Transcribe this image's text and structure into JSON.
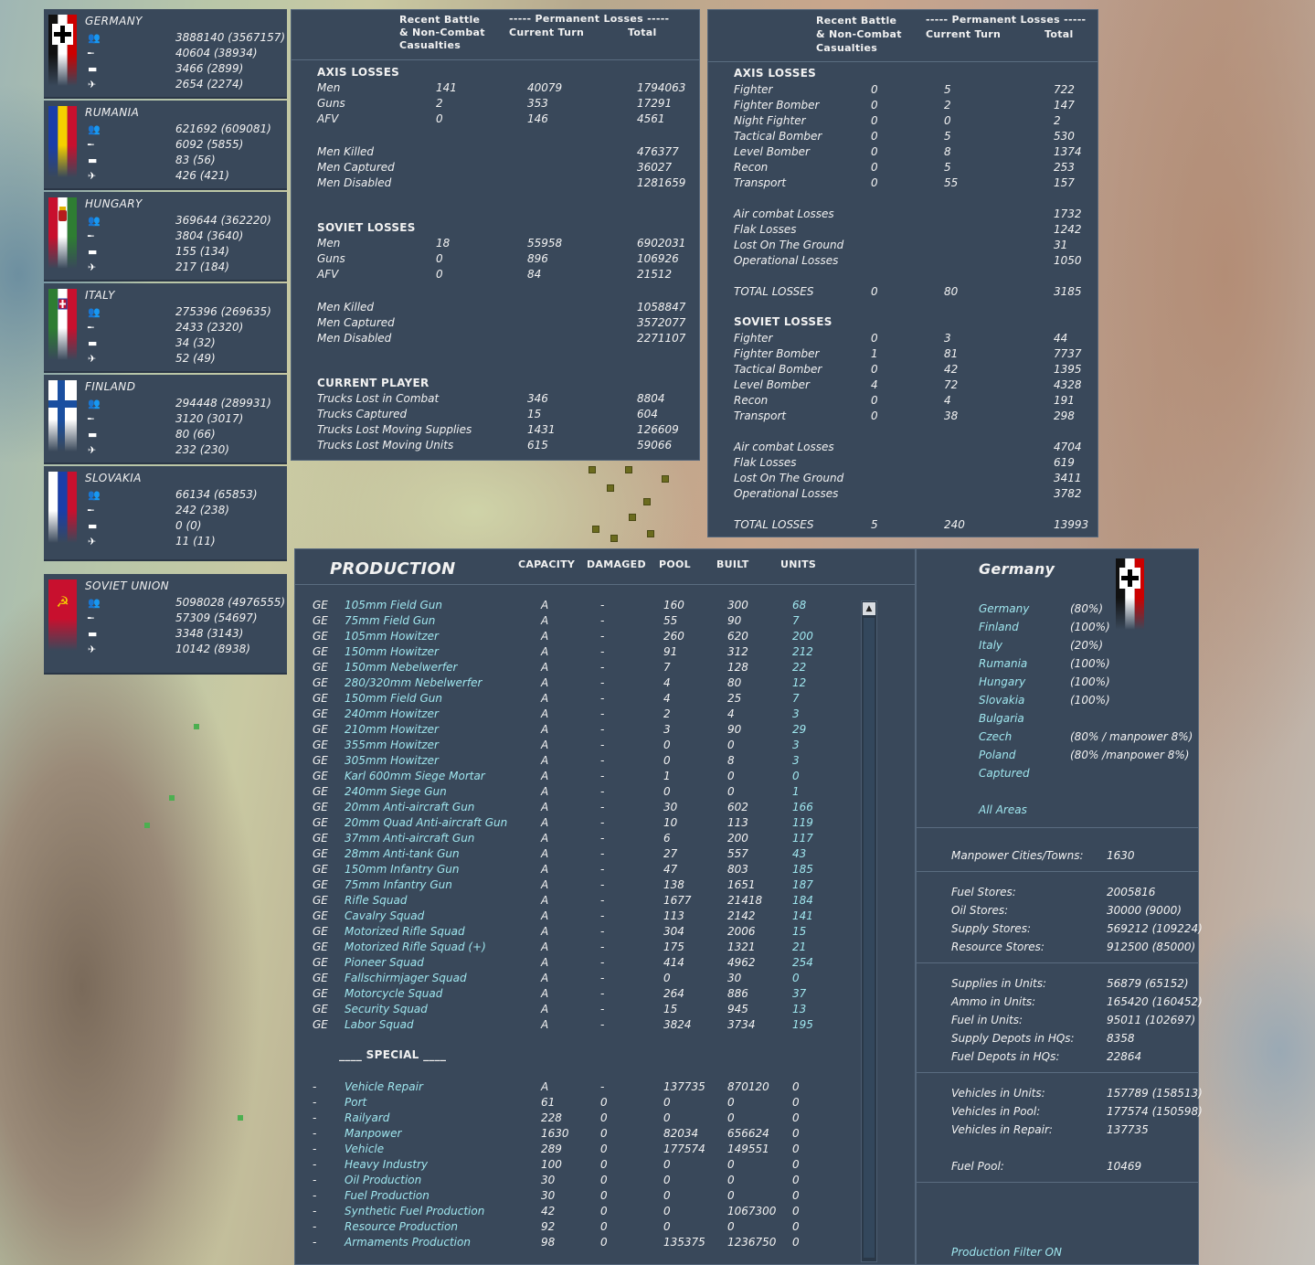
{
  "nations": [
    {
      "name": "GERMANY",
      "flag": "germany",
      "men": "3888140 (3567157)",
      "guns": "40604 (38934)",
      "afv": "3466 (2899)",
      "air": "2654 (2274)"
    },
    {
      "name": "RUMANIA",
      "flag": "rumania",
      "men": "621692 (609081)",
      "guns": "6092 (5855)",
      "afv": "83 (56)",
      "air": "426 (421)"
    },
    {
      "name": "HUNGARY",
      "flag": "hungary",
      "men": "369644 (362220)",
      "guns": "3804 (3640)",
      "afv": "155 (134)",
      "air": "217 (184)"
    },
    {
      "name": "ITALY",
      "flag": "italy",
      "men": "275396 (269635)",
      "guns": "2433 (2320)",
      "afv": "34 (32)",
      "air": "52 (49)"
    },
    {
      "name": "FINLAND",
      "flag": "finland",
      "men": "294448 (289931)",
      "guns": "3120 (3017)",
      "afv": "80 (66)",
      "air": "232 (230)"
    },
    {
      "name": "SLOVAKIA",
      "flag": "slovakia",
      "men": "66134 (65853)",
      "guns": "242 (238)",
      "afv": "0 (0)",
      "air": "11 (11)"
    },
    {
      "name": "SOVIET UNION",
      "flag": "soviet",
      "men": "5098028 (4976555)",
      "guns": "57309 (54697)",
      "afv": "3348 (3143)",
      "air": "10142 (8938)"
    }
  ],
  "ground_losses": {
    "hdr": {
      "recent": "Recent Battle",
      "recent2": "& Non-Combat",
      "recent3": "Casualties",
      "perm": "----- Permanent Losses -----",
      "cur": "Current Turn",
      "total": "Total"
    },
    "axis_title": "AXIS LOSSES",
    "axis_rows": [
      [
        "Men",
        "141",
        "40079",
        "1794063"
      ],
      [
        "Guns",
        "2",
        "353",
        "17291"
      ],
      [
        "AFV",
        "0",
        "146",
        "4561"
      ]
    ],
    "axis_detail": [
      [
        "Men Killed",
        "476377"
      ],
      [
        "Men Captured",
        "36027"
      ],
      [
        "Men Disabled",
        "1281659"
      ]
    ],
    "soviet_title": "SOVIET LOSSES",
    "soviet_rows": [
      [
        "Men",
        "18",
        "55958",
        "6902031"
      ],
      [
        "Guns",
        "0",
        "896",
        "106926"
      ],
      [
        "AFV",
        "0",
        "84",
        "21512"
      ]
    ],
    "soviet_detail": [
      [
        "Men Killed",
        "1058847"
      ],
      [
        "Men Captured",
        "3572077"
      ],
      [
        "Men Disabled",
        "2271107"
      ]
    ],
    "cp_title": "CURRENT PLAYER",
    "cp_rows": [
      [
        "Trucks Lost in Combat",
        "346",
        "8804"
      ],
      [
        "Trucks Captured",
        "15",
        "604"
      ],
      [
        "Trucks Lost Moving Supplies",
        "1431",
        "126609"
      ],
      [
        "Trucks Lost Moving Units",
        "615",
        "59066"
      ]
    ]
  },
  "air_losses": {
    "hdr": {
      "recent": "Recent Battle",
      "recent2": "& Non-Combat",
      "recent3": "Casualties",
      "perm": "----- Permanent Losses -----",
      "cur": "Current Turn",
      "total": "Total"
    },
    "axis_title": "AXIS LOSSES",
    "axis_rows": [
      [
        "Fighter",
        "0",
        "5",
        "722"
      ],
      [
        "Fighter Bomber",
        "0",
        "2",
        "147"
      ],
      [
        "Night Fighter",
        "0",
        "0",
        "2"
      ],
      [
        "Tactical Bomber",
        "0",
        "5",
        "530"
      ],
      [
        "Level Bomber",
        "0",
        "8",
        "1374"
      ],
      [
        "Recon",
        "0",
        "5",
        "253"
      ],
      [
        "Transport",
        "0",
        "55",
        "157"
      ]
    ],
    "axis_detail": [
      [
        "Air combat Losses",
        "1732"
      ],
      [
        "Flak Losses",
        "1242"
      ],
      [
        "Lost On The Ground",
        "31"
      ],
      [
        "Operational Losses",
        "1050"
      ]
    ],
    "axis_total": [
      "TOTAL LOSSES",
      "0",
      "80",
      "3185"
    ],
    "soviet_title": "SOVIET LOSSES",
    "soviet_rows": [
      [
        "Fighter",
        "0",
        "3",
        "44"
      ],
      [
        "Fighter Bomber",
        "1",
        "81",
        "7737"
      ],
      [
        "Tactical Bomber",
        "0",
        "42",
        "1395"
      ],
      [
        "Level Bomber",
        "4",
        "72",
        "4328"
      ],
      [
        "Recon",
        "0",
        "4",
        "191"
      ],
      [
        "Transport",
        "0",
        "38",
        "298"
      ]
    ],
    "soviet_detail": [
      [
        "Air combat Losses",
        "4704"
      ],
      [
        "Flak Losses",
        "619"
      ],
      [
        "Lost On The Ground",
        "3411"
      ],
      [
        "Operational Losses",
        "3782"
      ]
    ],
    "soviet_total": [
      "TOTAL LOSSES",
      "5",
      "240",
      "13993"
    ]
  },
  "production": {
    "title": "PRODUCTION",
    "cols": [
      "CAPACITY",
      "DAMAGED",
      "POOL",
      "BUILT",
      "UNITS"
    ],
    "rows": [
      [
        "GE",
        "105mm Field Gun",
        "A",
        "-",
        "160",
        "300",
        "68"
      ],
      [
        "GE",
        "75mm Field Gun",
        "A",
        "-",
        "55",
        "90",
        "7"
      ],
      [
        "GE",
        "105mm Howitzer",
        "A",
        "-",
        "260",
        "620",
        "200"
      ],
      [
        "GE",
        "150mm Howitzer",
        "A",
        "-",
        "91",
        "312",
        "212"
      ],
      [
        "GE",
        "150mm Nebelwerfer",
        "A",
        "-",
        "7",
        "128",
        "22"
      ],
      [
        "GE",
        "280/320mm Nebelwerfer",
        "A",
        "-",
        "4",
        "80",
        "12"
      ],
      [
        "GE",
        "150mm Field Gun",
        "A",
        "-",
        "4",
        "25",
        "7"
      ],
      [
        "GE",
        "240mm Howitzer",
        "A",
        "-",
        "2",
        "4",
        "3"
      ],
      [
        "GE",
        "210mm Howitzer",
        "A",
        "-",
        "3",
        "90",
        "29"
      ],
      [
        "GE",
        "355mm Howitzer",
        "A",
        "-",
        "0",
        "0",
        "3"
      ],
      [
        "GE",
        "305mm Howitzer",
        "A",
        "-",
        "0",
        "8",
        "3"
      ],
      [
        "GE",
        "Karl 600mm Siege Mortar",
        "A",
        "-",
        "1",
        "0",
        "0"
      ],
      [
        "GE",
        "240mm Siege Gun",
        "A",
        "-",
        "0",
        "0",
        "1"
      ],
      [
        "GE",
        "20mm Anti-aircraft Gun",
        "A",
        "-",
        "30",
        "602",
        "166"
      ],
      [
        "GE",
        "20mm Quad Anti-aircraft Gun",
        "A",
        "-",
        "10",
        "113",
        "119"
      ],
      [
        "GE",
        "37mm Anti-aircraft Gun",
        "A",
        "-",
        "6",
        "200",
        "117"
      ],
      [
        "GE",
        "28mm Anti-tank Gun",
        "A",
        "-",
        "27",
        "557",
        "43"
      ],
      [
        "GE",
        "150mm Infantry Gun",
        "A",
        "-",
        "47",
        "803",
        "185"
      ],
      [
        "GE",
        "75mm Infantry Gun",
        "A",
        "-",
        "138",
        "1651",
        "187"
      ],
      [
        "GE",
        "Rifle Squad",
        "A",
        "-",
        "1677",
        "21418",
        "184"
      ],
      [
        "GE",
        "Cavalry Squad",
        "A",
        "-",
        "113",
        "2142",
        "141"
      ],
      [
        "GE",
        "Motorized Rifle Squad",
        "A",
        "-",
        "304",
        "2006",
        "15"
      ],
      [
        "GE",
        "Motorized Rifle Squad (+)",
        "A",
        "-",
        "175",
        "1321",
        "21"
      ],
      [
        "GE",
        "Pioneer Squad",
        "A",
        "-",
        "414",
        "4962",
        "254"
      ],
      [
        "GE",
        "Fallschirmjager Squad",
        "A",
        "-",
        "0",
        "30",
        "0"
      ],
      [
        "GE",
        "Motorcycle Squad",
        "A",
        "-",
        "264",
        "886",
        "37"
      ],
      [
        "GE",
        "Security Squad",
        "A",
        "-",
        "15",
        "945",
        "13"
      ],
      [
        "GE",
        "Labor Squad",
        "A",
        "-",
        "3824",
        "3734",
        "195"
      ]
    ],
    "special_title": "____ SPECIAL ____",
    "special_rows": [
      [
        "-",
        "Vehicle Repair",
        "A",
        "-",
        "137735",
        "870120",
        "0"
      ],
      [
        "-",
        "Port",
        "61",
        "0",
        "0",
        "0",
        "0"
      ],
      [
        "-",
        "Railyard",
        "228",
        "0",
        "0",
        "0",
        "0"
      ],
      [
        "-",
        "Manpower",
        "1630",
        "0",
        "82034",
        "656624",
        "0"
      ],
      [
        "-",
        "Vehicle",
        "289",
        "0",
        "177574",
        "149551",
        "0"
      ],
      [
        "-",
        "Heavy Industry",
        "100",
        "0",
        "0",
        "0",
        "0"
      ],
      [
        "-",
        "Oil Production",
        "30",
        "0",
        "0",
        "0",
        "0"
      ],
      [
        "-",
        "Fuel Production",
        "30",
        "0",
        "0",
        "0",
        "0"
      ],
      [
        "-",
        "Synthetic Fuel Production",
        "42",
        "0",
        "0",
        "1067300",
        "0"
      ],
      [
        "-",
        "Resource Production",
        "92",
        "0",
        "0",
        "0",
        "0"
      ],
      [
        "-",
        "Armaments Production",
        "98",
        "0",
        "135375",
        "1236750",
        "0"
      ]
    ],
    "scroll_up": "▲"
  },
  "filter": {
    "title": "Germany",
    "areas": [
      [
        "Germany",
        "(80%)"
      ],
      [
        "Finland",
        "(100%)"
      ],
      [
        "Italy",
        "(20%)"
      ],
      [
        "Rumania",
        "(100%)"
      ],
      [
        "Hungary",
        "(100%)"
      ],
      [
        "Slovakia",
        "(100%)"
      ],
      [
        "Bulgaria",
        ""
      ],
      [
        "Czech",
        "(80% / manpower 8%)"
      ],
      [
        "Poland",
        "(80% /manpower 8%)"
      ],
      [
        "Captured",
        ""
      ]
    ],
    "all_areas": "All Areas",
    "manpower": [
      "Manpower Cities/Towns:",
      "1630"
    ],
    "stores": [
      [
        "Fuel Stores:",
        "2005816"
      ],
      [
        "Oil Stores:",
        "30000 (9000)"
      ],
      [
        "Supply Stores:",
        "569212 (109224)"
      ],
      [
        "Resource Stores:",
        "912500 (85000)"
      ]
    ],
    "units": [
      [
        "Supplies in Units:",
        "56879 (65152)"
      ],
      [
        "Ammo in Units:",
        "165420 (160452)"
      ],
      [
        "Fuel in Units:",
        "95011 (102697)"
      ],
      [
        "Supply Depots in HQs:",
        "8358"
      ],
      [
        "Fuel Depots in HQs:",
        "22864"
      ]
    ],
    "vehicles": [
      [
        "Vehicles in Units:",
        "157789 (158513)"
      ],
      [
        "Vehicles in Pool:",
        "177574 (150598)"
      ],
      [
        "Vehicles in Repair:",
        "137735"
      ]
    ],
    "fuel_pool": [
      "Fuel Pool:",
      "10469"
    ],
    "prod_filter": "Production Filter ON"
  },
  "colors": {
    "panel": "#39485a",
    "cyan": "#9fe6ee",
    "text": "#f2f2f2"
  }
}
